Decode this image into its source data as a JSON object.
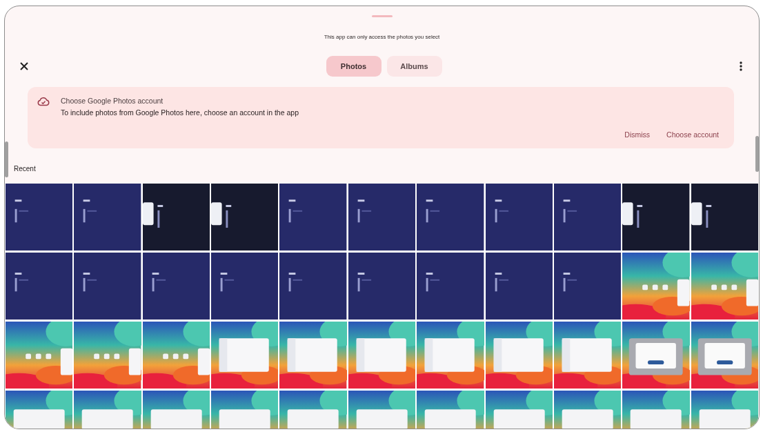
{
  "notice": "This app can only access the photos you select",
  "tabs": [
    {
      "label": "Photos",
      "selected": true
    },
    {
      "label": "Albums",
      "selected": false
    }
  ],
  "banner": {
    "title": "Choose Google Photos account",
    "text": "To include photos from Google Photos here, choose an account in the app",
    "actions": [
      "Dismiss",
      "Choose account"
    ]
  },
  "section": "Recent"
}
